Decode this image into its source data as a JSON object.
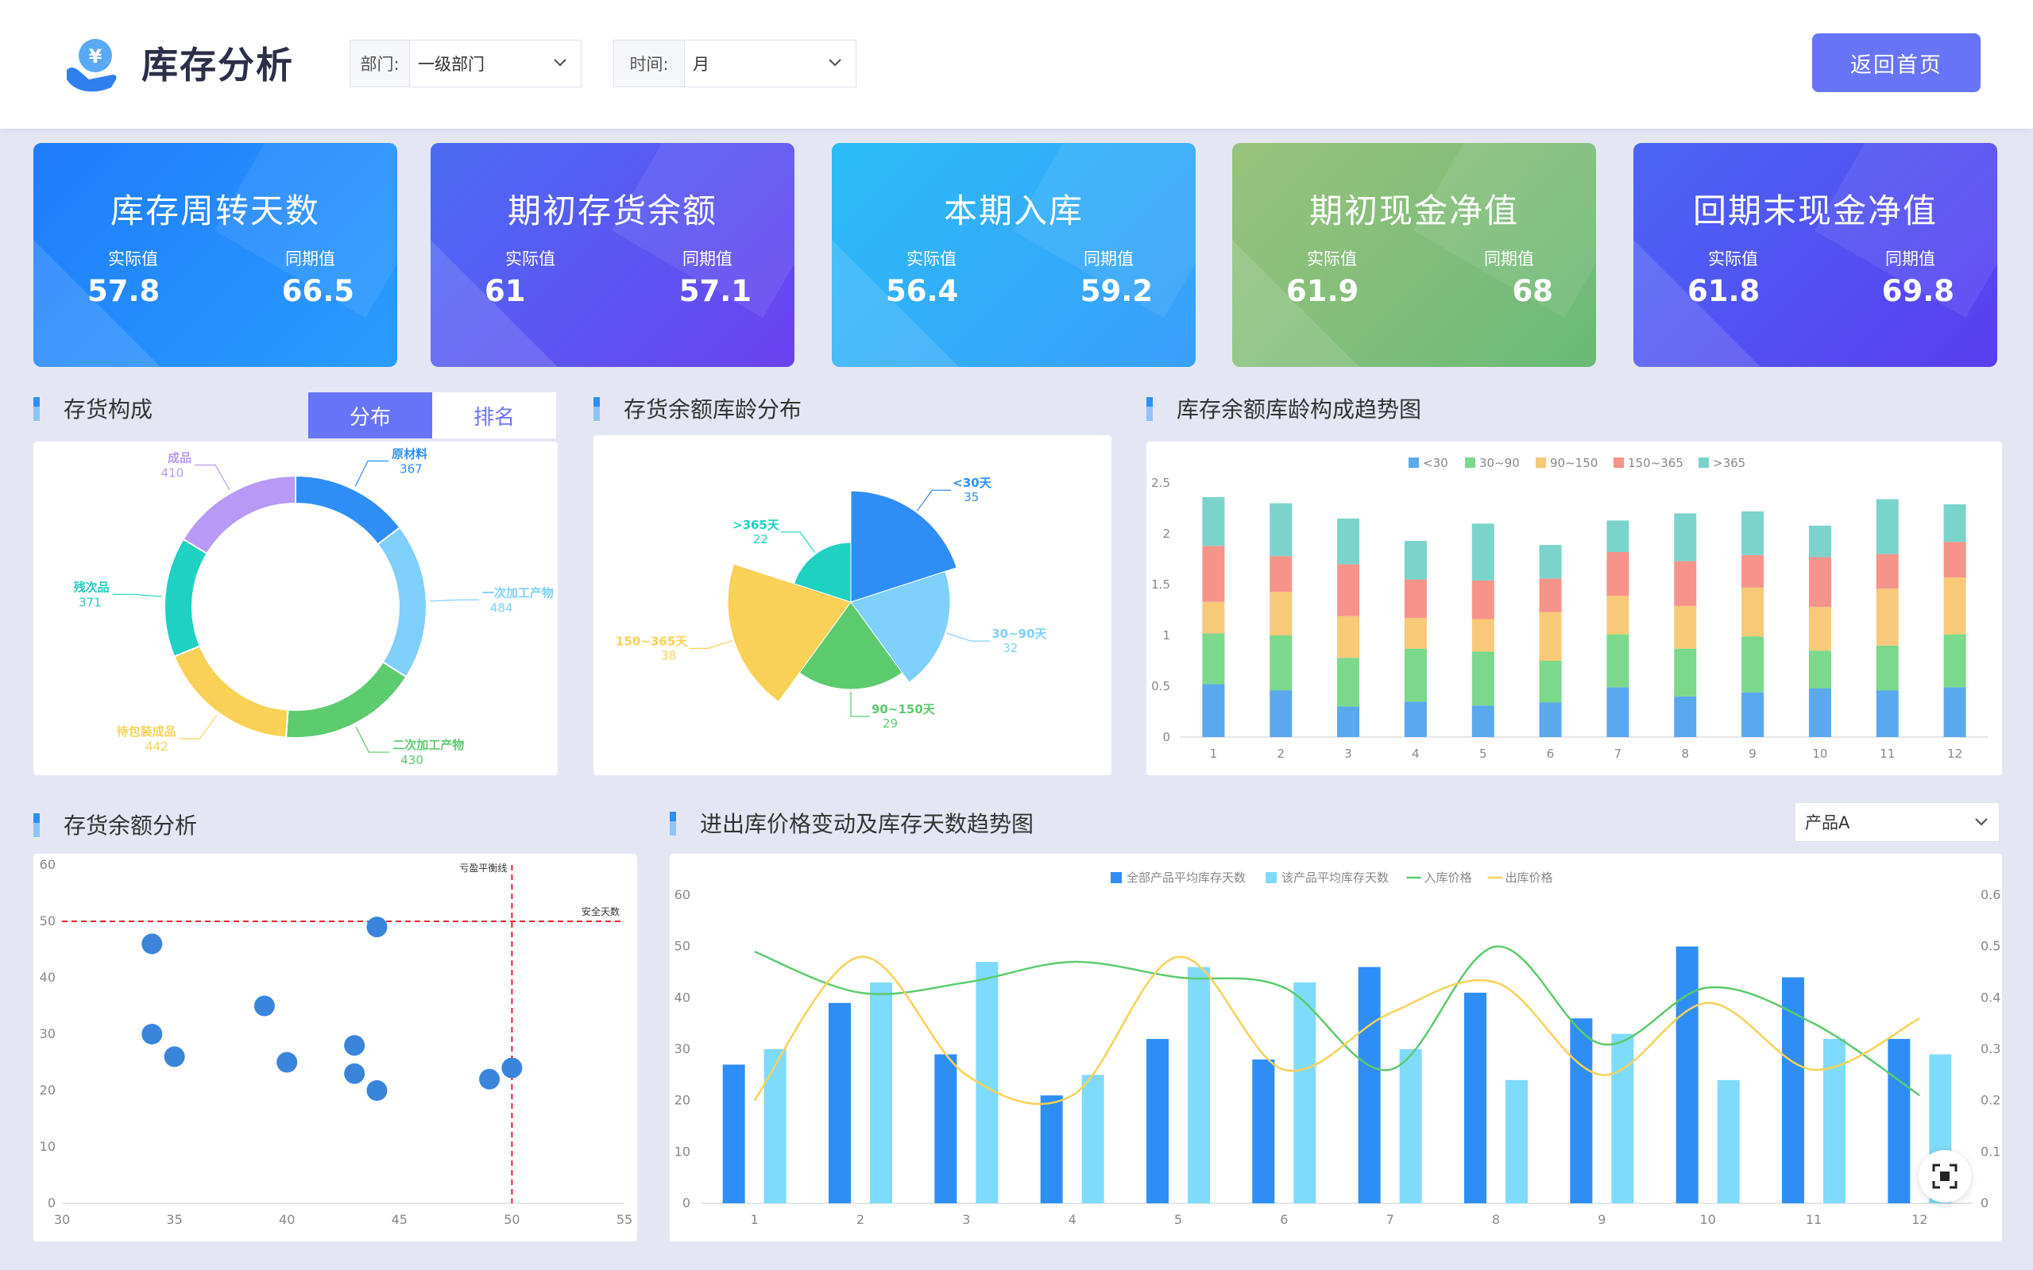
{
  "header": {
    "title": "库存分析",
    "dept_label": "部门:",
    "dept_value": "一级部门",
    "time_label": "时间:",
    "time_value": "月",
    "home_button": "返回首页",
    "logo_glyph": "¥"
  },
  "kpis": [
    {
      "title": "库存周转天数",
      "actual_label": "实际值",
      "actual": "57.8",
      "prior_label": "同期值",
      "prior": "66.5",
      "colors": [
        "#1f7cfb",
        "#2a9cff"
      ]
    },
    {
      "title": "期初存货余额",
      "actual_label": "实际值",
      "actual": "61",
      "prior_label": "同期值",
      "prior": "57.1",
      "colors": [
        "#4b6cf5",
        "#6a42ef"
      ]
    },
    {
      "title": "本期入库",
      "actual_label": "实际值",
      "actual": "56.4",
      "prior_label": "同期值",
      "prior": "59.2",
      "colors": [
        "#2bbcf8",
        "#3a9efb"
      ]
    },
    {
      "title": "期初现金净值",
      "actual_label": "实际值",
      "actual": "61.9",
      "prior_label": "同期值",
      "prior": "68",
      "colors": [
        "#9ac27c",
        "#6aba78"
      ]
    },
    {
      "title": "回期末现金净值",
      "actual_label": "实际值",
      "actual": "61.8",
      "prior_label": "同期值",
      "prior": "69.8",
      "colors": [
        "#4a66f4",
        "#5a3ef0"
      ]
    }
  ],
  "sections": {
    "composition": "存货构成",
    "aging": "存货余额库龄分布",
    "trend": "库存余额库龄构成趋势图",
    "balance": "存货余额分析",
    "price": "进出库价格变动及库存天数趋势图"
  },
  "tabs": {
    "active": "分布",
    "inactive": "排名"
  },
  "product_select": "产品A",
  "chart_data": [
    {
      "type": "pie",
      "variant": "donut",
      "labels": [
        "原材料",
        "一次加工产物",
        "二次加工产物",
        "待包装成品",
        "残次品",
        "成品"
      ],
      "values": [
        367,
        484,
        430,
        442,
        371,
        410
      ],
      "colors": [
        "#2f8ef5",
        "#7fd0fb",
        "#5ccb6e",
        "#f8d156",
        "#1ed1c1",
        "#b89af6"
      ]
    },
    {
      "type": "pie",
      "variant": "rose",
      "labels": [
        "<30天",
        "30~90天",
        "90~150天",
        "150~365天",
        ">365天"
      ],
      "values": [
        35,
        32,
        29,
        38,
        22
      ],
      "colors": [
        "#2f8ef5",
        "#7fd0fb",
        "#5ccb6e",
        "#f8d156",
        "#1ed1c1"
      ]
    },
    {
      "type": "bar",
      "stacked": true,
      "categories": [
        "1",
        "2",
        "3",
        "4",
        "5",
        "6",
        "7",
        "8",
        "9",
        "10",
        "11",
        "12"
      ],
      "ylim": [
        0,
        2.5
      ],
      "yticks": [
        "0",
        "0.5",
        "1",
        "1.5",
        "2",
        "2.5"
      ],
      "legend_position": "top",
      "series": [
        {
          "name": "<30",
          "color": "#5aa9ef",
          "values": [
            0.52,
            0.46,
            0.3,
            0.35,
            0.31,
            0.34,
            0.49,
            0.4,
            0.44,
            0.48,
            0.46,
            0.49
          ]
        },
        {
          "name": "30~90",
          "color": "#7ad98b",
          "values": [
            0.5,
            0.54,
            0.48,
            0.52,
            0.53,
            0.41,
            0.52,
            0.47,
            0.55,
            0.37,
            0.44,
            0.52
          ]
        },
        {
          "name": "90~150",
          "color": "#f8c978",
          "values": [
            0.31,
            0.43,
            0.41,
            0.3,
            0.32,
            0.48,
            0.38,
            0.42,
            0.48,
            0.43,
            0.56,
            0.56
          ]
        },
        {
          "name": "150~365",
          "color": "#f6938a",
          "values": [
            0.55,
            0.35,
            0.51,
            0.38,
            0.38,
            0.33,
            0.43,
            0.44,
            0.32,
            0.49,
            0.34,
            0.35
          ]
        },
        {
          "name": ">365",
          "color": "#7bd4cc",
          "values": [
            0.48,
            0.52,
            0.45,
            0.38,
            0.56,
            0.33,
            0.31,
            0.47,
            0.43,
            0.31,
            0.54,
            0.37
          ]
        }
      ]
    },
    {
      "type": "scatter",
      "xlim": [
        30,
        55
      ],
      "ylim": [
        0,
        60
      ],
      "xticks": [
        "30",
        "35",
        "40",
        "45",
        "50",
        "55"
      ],
      "yticks": [
        "0",
        "10",
        "20",
        "30",
        "40",
        "50",
        "60"
      ],
      "points": [
        [
          34,
          46
        ],
        [
          34,
          30
        ],
        [
          35,
          26
        ],
        [
          39,
          35
        ],
        [
          40,
          25
        ],
        [
          43,
          28
        ],
        [
          43,
          23
        ],
        [
          44,
          20
        ],
        [
          44,
          49
        ],
        [
          49,
          22
        ],
        [
          50,
          24
        ]
      ],
      "ref_x": 50,
      "ref_y": 50,
      "ref_x_label": "亏盈平衡线",
      "ref_y_label": "安全天数",
      "point_color": "#3a85dc"
    },
    {
      "type": "bar",
      "combo": "bar+line",
      "categories": [
        "1",
        "2",
        "3",
        "4",
        "5",
        "6",
        "7",
        "8",
        "9",
        "10",
        "11",
        "12"
      ],
      "ylim": [
        0,
        60
      ],
      "y2lim": [
        0,
        0.6
      ],
      "yticks": [
        "0",
        "10",
        "20",
        "30",
        "40",
        "50",
        "60"
      ],
      "y2ticks": [
        "0",
        "0.1",
        "0.2",
        "0.3",
        "0.4",
        "0.5",
        "0.6"
      ],
      "legend_position": "top",
      "series": [
        {
          "name": "全部产品平均库存天数",
          "kind": "bar",
          "color": "#2f8ef5",
          "values": [
            27,
            39,
            29,
            21,
            32,
            28,
            46,
            41,
            36,
            50,
            44,
            32
          ]
        },
        {
          "name": "该产品平均库存天数",
          "kind": "bar",
          "color": "#7fdbfb",
          "values": [
            30,
            43,
            47,
            25,
            46,
            43,
            30,
            24,
            33,
            24,
            32,
            29
          ]
        },
        {
          "name": "入库价格",
          "kind": "line",
          "axis": "right",
          "color": "#5ccb6e",
          "values": [
            0.49,
            0.41,
            0.43,
            0.47,
            0.44,
            0.42,
            0.26,
            0.5,
            0.31,
            0.42,
            0.35,
            0.21
          ]
        },
        {
          "name": "出库价格",
          "kind": "line",
          "axis": "right",
          "color": "#f8d156",
          "values": [
            0.2,
            0.48,
            0.25,
            0.21,
            0.48,
            0.26,
            0.37,
            0.43,
            0.25,
            0.39,
            0.26,
            0.36
          ]
        }
      ]
    }
  ]
}
